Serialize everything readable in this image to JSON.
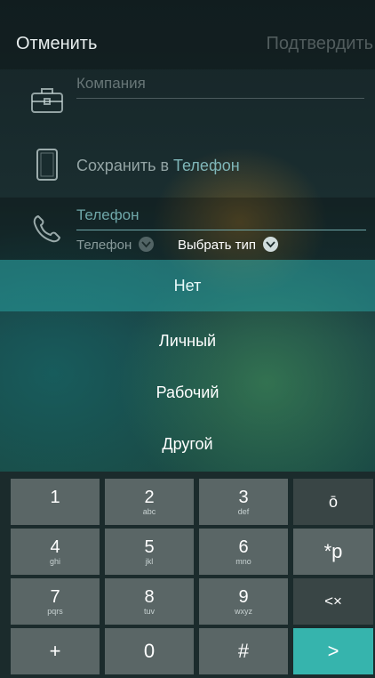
{
  "header": {
    "cancel_label": "Отменить",
    "confirm_label": "Подтвердить"
  },
  "form": {
    "company_placeholder": "Компания",
    "save_to_label": "Сохранить в",
    "save_to_value": "Телефон",
    "phone_placeholder": "Телефон",
    "phone_type_value": "Телефон",
    "choose_type_label": "Выбрать тип"
  },
  "dropdown": {
    "options": [
      "Нет",
      "Личный",
      "Рабочий",
      "Другой"
    ],
    "selected": "Нет"
  },
  "keyboard": {
    "keys": [
      {
        "main": "1",
        "sub": ""
      },
      {
        "main": "2",
        "sub": "abc"
      },
      {
        "main": "3",
        "sub": "def"
      },
      {
        "main": "4",
        "sub": "ghi"
      },
      {
        "main": "5",
        "sub": "jkl"
      },
      {
        "main": "6",
        "sub": "mno"
      },
      {
        "main": "7",
        "sub": "pqrs"
      },
      {
        "main": "8",
        "sub": "tuv"
      },
      {
        "main": "9",
        "sub": "wxyz"
      },
      {
        "main": "+",
        "sub": ""
      },
      {
        "main": "0",
        "sub": ""
      },
      {
        "main": "#",
        "sub": ""
      }
    ],
    "side_keys": {
      "hide": "ō",
      "star_p": "*p",
      "backspace": "<×",
      "next": ">"
    }
  },
  "colors": {
    "accent": "#36b4ad",
    "selected_option_bg": "#2aa0a0"
  }
}
